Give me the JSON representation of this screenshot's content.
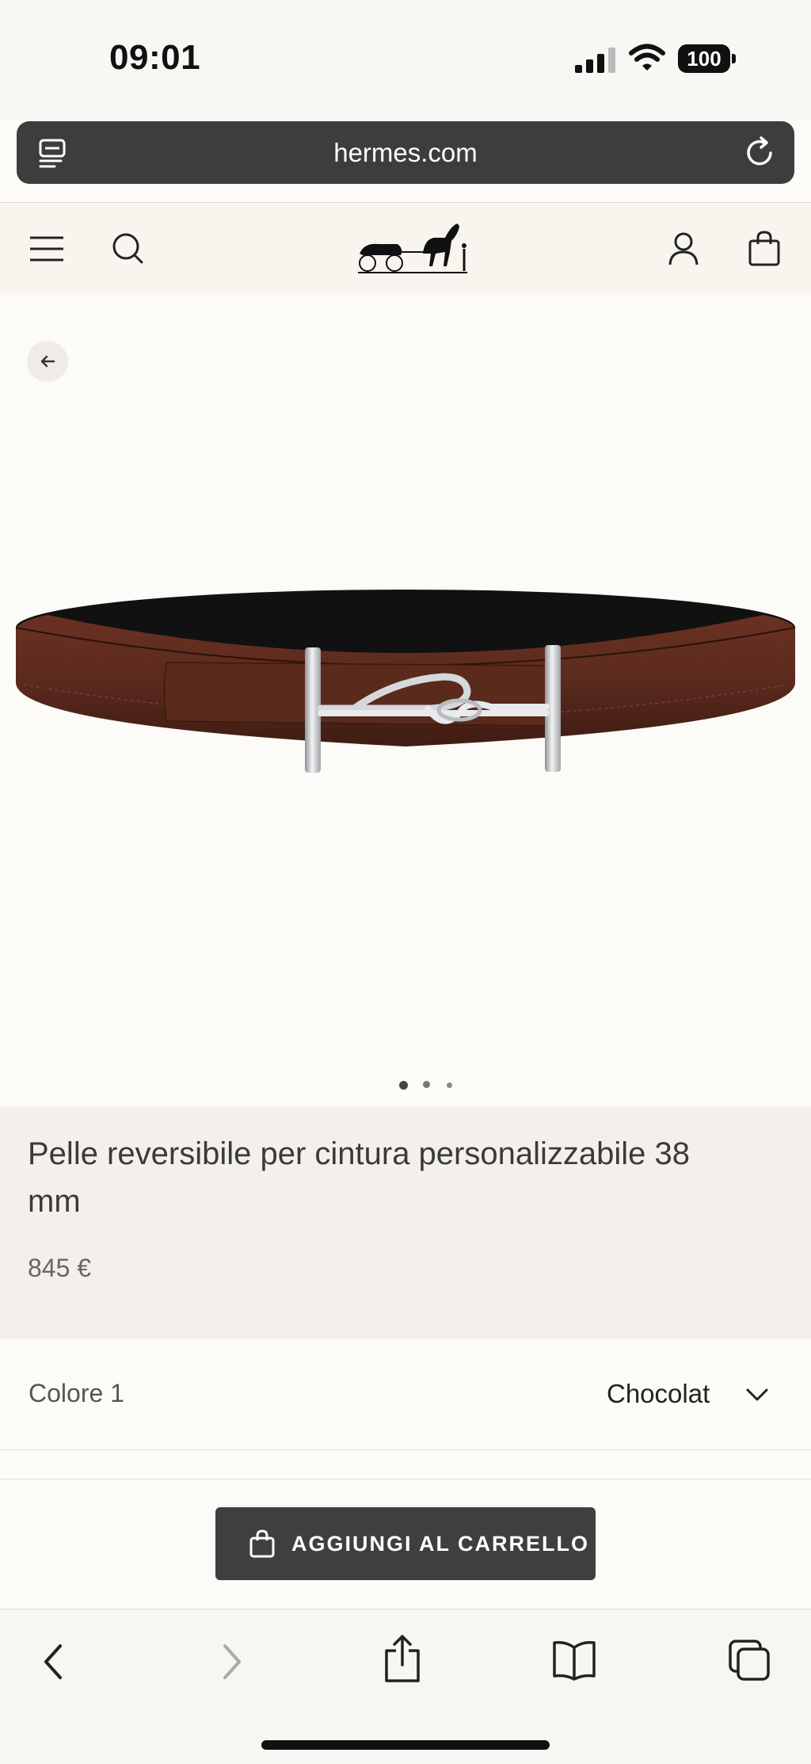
{
  "status_bar": {
    "time": "09:01",
    "battery": "100",
    "icons": [
      "signal-icon",
      "wifi-icon",
      "battery-icon"
    ]
  },
  "browser": {
    "url": "hermes.com",
    "icons": [
      "reader-icon",
      "reload-icon"
    ]
  },
  "header": {
    "icons": [
      "menu-icon",
      "search-icon",
      "hermes-logo-icon",
      "account-icon",
      "shopping-bag-icon"
    ]
  },
  "gallery": {
    "back_icon": "arrow-left-icon",
    "dots_total": 3,
    "dot_active": 1
  },
  "product": {
    "title": "Pelle reversibile per cintura personalizzabile 38 mm",
    "price": "845 €",
    "colors": {
      "outer": "#5b2a1e",
      "inner": "#111111",
      "buckle": "#c9ccd0"
    }
  },
  "options": {
    "colour_label": "Colore 1",
    "colour_value": "Chocolat"
  },
  "cart": {
    "button_label": "AGGIUNGI AL CARRELLO",
    "icon": "shopping-bag-icon"
  },
  "toolbar": {
    "icons": [
      "back-icon",
      "forward-icon",
      "share-icon",
      "bookmarks-icon",
      "tabs-icon"
    ]
  }
}
